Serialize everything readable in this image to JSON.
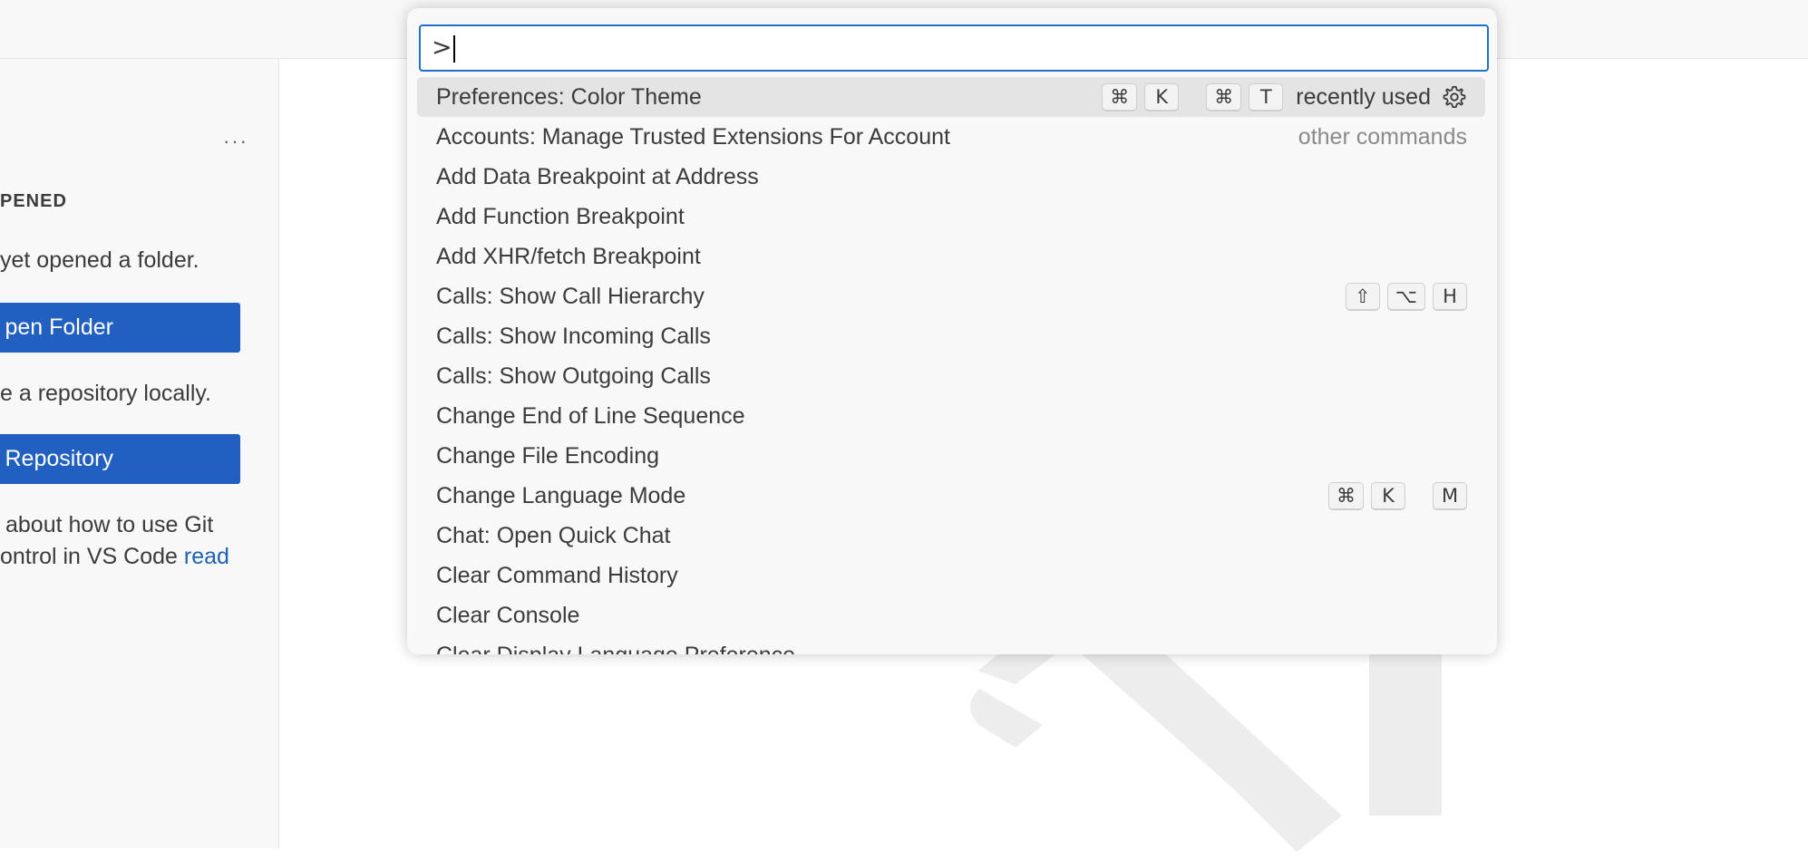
{
  "sidebar": {
    "more_label": "···",
    "section_title": "PENED",
    "no_folder_text": "yet opened a folder.",
    "open_folder_button": "pen Folder",
    "clone_text": "e a repository locally.",
    "clone_button": "ne Repository",
    "git_text_line1": "about how to use Git",
    "git_text_line2": "ontrol in VS Code",
    "git_link": "read"
  },
  "palette": {
    "input_value": ">",
    "items": [
      {
        "label": "Preferences: Color Theme",
        "keys": [
          [
            "⌘",
            "K"
          ],
          [
            "⌘",
            "T"
          ]
        ],
        "tag": "recently used",
        "gear": true
      },
      {
        "label": "Accounts: Manage Trusted Extensions For Account",
        "tag": "other commands"
      },
      {
        "label": "Add Data Breakpoint at Address"
      },
      {
        "label": "Add Function Breakpoint"
      },
      {
        "label": "Add XHR/fetch Breakpoint"
      },
      {
        "label": "Calls: Show Call Hierarchy",
        "keys": [
          [
            "⇧",
            "⌥",
            "H"
          ]
        ]
      },
      {
        "label": "Calls: Show Incoming Calls"
      },
      {
        "label": "Calls: Show Outgoing Calls"
      },
      {
        "label": "Change End of Line Sequence"
      },
      {
        "label": "Change File Encoding"
      },
      {
        "label": "Change Language Mode",
        "keys": [
          [
            "⌘",
            "K"
          ],
          [
            "M"
          ]
        ]
      },
      {
        "label": "Chat: Open Quick Chat"
      },
      {
        "label": "Clear Command History"
      },
      {
        "label": "Clear Console"
      },
      {
        "label": "Clear Display Language Preference"
      }
    ]
  },
  "colors": {
    "accent": "#1f6fd0",
    "button": "#2160c0",
    "link": "#1e5fb8"
  },
  "icons": {
    "gear": "gear-icon",
    "watermark": "vscode-logo-watermark"
  }
}
